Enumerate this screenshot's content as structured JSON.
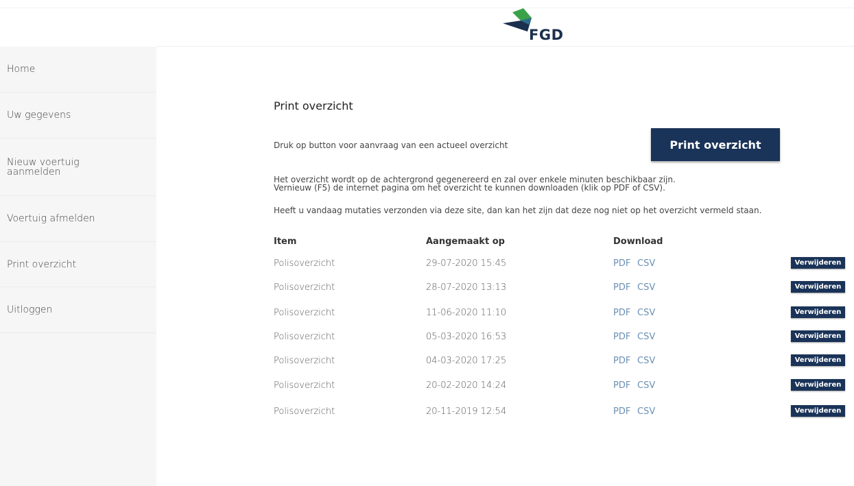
{
  "header": {
    "logo_text": "FGD"
  },
  "sidebar": {
    "items": [
      {
        "label": "Home"
      },
      {
        "label": "Uw gegevens"
      },
      {
        "label_line1": "Nieuw voertuig",
        "label_line2": "aanmelden"
      },
      {
        "label": "Voertuig afmelden"
      },
      {
        "label": "Print overzicht"
      },
      {
        "label": "Uitloggen"
      }
    ]
  },
  "main": {
    "title": "Print overzicht",
    "intro": "Druk op button voor aanvraag van een actueel overzicht",
    "print_button": "Print overzicht",
    "info_line1": "Het overzicht wordt op de achtergrond gegenereerd en zal over enkele minuten beschikbaar zijn.",
    "info_line2": "Vernieuw (F5) de internet pagina om het overzicht te kunnen downloaden (klik op PDF of CSV).",
    "info_line3": "Heeft u vandaag mutaties verzonden via deze site, dan kan het zijn dat deze nog niet op het overzicht vermeld staan.",
    "table": {
      "headers": {
        "item": "Item",
        "created": "Aangemaakt op",
        "download": "Download"
      },
      "pdf_label": "PDF",
      "csv_label": "CSV",
      "delete_label": "Verwijderen",
      "rows": [
        {
          "item": "Polisoverzicht",
          "created": "29-07-2020 15:45"
        },
        {
          "item": "Polisoverzicht",
          "created": "28-07-2020 13:13"
        },
        {
          "item": "Polisoverzicht",
          "created": "11-06-2020 11:10"
        },
        {
          "item": "Polisoverzicht",
          "created": "05-03-2020 16:53"
        },
        {
          "item": "Polisoverzicht",
          "created": "04-03-2020 17:25"
        },
        {
          "item": "Polisoverzicht",
          "created": "20-02-2020 14:24"
        },
        {
          "item": "Polisoverzicht",
          "created": "20-11-2019 12:54"
        }
      ]
    }
  },
  "colors": {
    "brand_navy": "#1a3358",
    "link_blue": "#6b8fb3",
    "sidebar_bg": "#f6f6f6"
  }
}
